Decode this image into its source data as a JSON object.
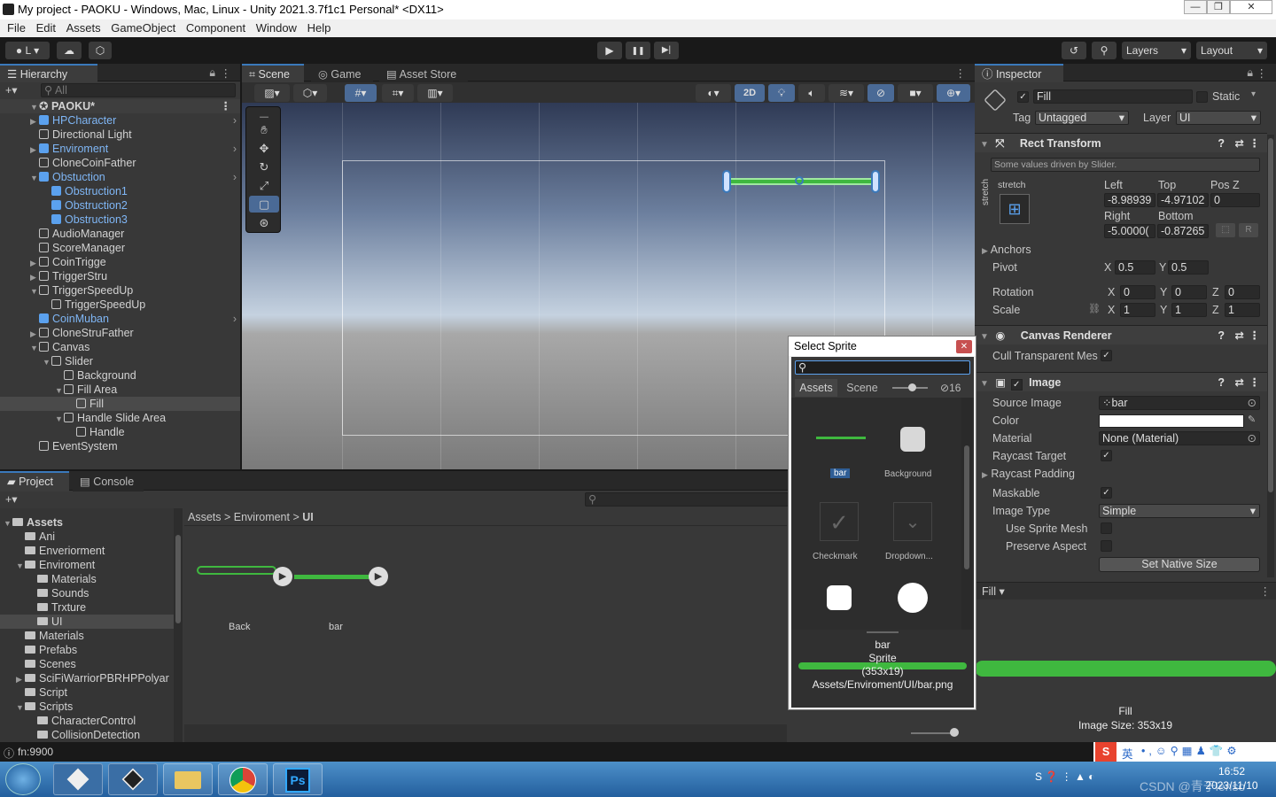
{
  "window": {
    "title": "My project - PAOKU - Windows, Mac, Linux - Unity 2021.3.7f1c1 Personal* <DX11>",
    "min": "—",
    "max": "❐",
    "close": "✕"
  },
  "menu": [
    "File",
    "Edit",
    "Assets",
    "GameObject",
    "Component",
    "Window",
    "Help"
  ],
  "toolbar": {
    "account": "L",
    "layers": "Layers",
    "layout": "Layout",
    "play": "▶",
    "pause": "❚❚",
    "step": "▶|"
  },
  "hierarchy": {
    "tab": "Hierarchy",
    "search_placeholder": "All",
    "scene": "PAOKU*",
    "items": [
      {
        "label": "HPCharacter",
        "prefab": true,
        "depth": 1,
        "fold": "▶"
      },
      {
        "label": "Directional Light",
        "prefab": false,
        "depth": 1,
        "fold": ""
      },
      {
        "label": "Enviroment",
        "prefab": true,
        "depth": 1,
        "fold": "▶"
      },
      {
        "label": "CloneCoinFather",
        "prefab": false,
        "depth": 1,
        "fold": ""
      },
      {
        "label": "Obstuction",
        "prefab": true,
        "depth": 1,
        "fold": "▼"
      },
      {
        "label": "Obstruction1",
        "prefab": true,
        "depth": 2,
        "fold": ""
      },
      {
        "label": "Obstruction2",
        "prefab": true,
        "depth": 2,
        "fold": ""
      },
      {
        "label": "Obstruction3",
        "prefab": true,
        "depth": 2,
        "fold": ""
      },
      {
        "label": "AudioManager",
        "prefab": false,
        "depth": 1,
        "fold": ""
      },
      {
        "label": "ScoreManager",
        "prefab": false,
        "depth": 1,
        "fold": ""
      },
      {
        "label": "CoinTrigge",
        "prefab": false,
        "depth": 1,
        "fold": "▶"
      },
      {
        "label": "TriggerStru",
        "prefab": false,
        "depth": 1,
        "fold": "▶"
      },
      {
        "label": "TriggerSpeedUp",
        "prefab": false,
        "depth": 1,
        "fold": "▼"
      },
      {
        "label": "TriggerSpeedUp",
        "prefab": false,
        "depth": 2,
        "fold": ""
      },
      {
        "label": "CoinMuban",
        "prefab": true,
        "depth": 1,
        "fold": ""
      },
      {
        "label": "CloneStruFather",
        "prefab": false,
        "depth": 1,
        "fold": "▶"
      },
      {
        "label": "Canvas",
        "prefab": false,
        "depth": 1,
        "fold": "▼"
      },
      {
        "label": "Slider",
        "prefab": false,
        "depth": 2,
        "fold": "▼"
      },
      {
        "label": "Background",
        "prefab": false,
        "depth": 3,
        "fold": ""
      },
      {
        "label": "Fill Area",
        "prefab": false,
        "depth": 3,
        "fold": "▼"
      },
      {
        "label": "Fill",
        "prefab": false,
        "depth": 4,
        "fold": "",
        "selected": true
      },
      {
        "label": "Handle Slide Area",
        "prefab": false,
        "depth": 3,
        "fold": "▼"
      },
      {
        "label": "Handle",
        "prefab": false,
        "depth": 4,
        "fold": ""
      },
      {
        "label": "EventSystem",
        "prefab": false,
        "depth": 1,
        "fold": ""
      }
    ]
  },
  "scene": {
    "tabs": [
      "Scene",
      "Game",
      "Asset Store"
    ],
    "btn2d": "2D"
  },
  "project": {
    "tabs": [
      "Project",
      "Console"
    ],
    "breadcrumb": [
      "Assets",
      "Enviroment",
      "UI"
    ],
    "tree": [
      {
        "label": "Assets",
        "depth": 0,
        "fold": "▼",
        "bold": true
      },
      {
        "label": "Ani",
        "depth": 1,
        "fold": ""
      },
      {
        "label": "Enveriorment",
        "depth": 1,
        "fold": ""
      },
      {
        "label": "Enviroment",
        "depth": 1,
        "fold": "▼"
      },
      {
        "label": "Materials",
        "depth": 2,
        "fold": ""
      },
      {
        "label": "Sounds",
        "depth": 2,
        "fold": ""
      },
      {
        "label": "Trxture",
        "depth": 2,
        "fold": ""
      },
      {
        "label": "UI",
        "depth": 2,
        "fold": "",
        "selected": true
      },
      {
        "label": "Materials",
        "depth": 1,
        "fold": ""
      },
      {
        "label": "Prefabs",
        "depth": 1,
        "fold": ""
      },
      {
        "label": "Scenes",
        "depth": 1,
        "fold": ""
      },
      {
        "label": "SciFiWarriorPBRHPPolyar",
        "depth": 1,
        "fold": "▶"
      },
      {
        "label": "Script",
        "depth": 1,
        "fold": ""
      },
      {
        "label": "Scripts",
        "depth": 1,
        "fold": "▼"
      },
      {
        "label": "CharacterControl",
        "depth": 2,
        "fold": ""
      },
      {
        "label": "CollisionDetection",
        "depth": 2,
        "fold": ""
      }
    ],
    "assets": [
      "Back",
      "bar"
    ]
  },
  "inspector": {
    "tab": "Inspector",
    "object_name": "Fill",
    "static_label": "Static",
    "tag_label": "Tag",
    "tag_value": "Untagged",
    "layer_label": "Layer",
    "layer_value": "UI",
    "rect": {
      "title": "Rect Transform",
      "note": "Some values driven by Slider.",
      "stretch": "stretch",
      "stretch_v": "stretch",
      "left_label": "Left",
      "top_label": "Top",
      "posz_label": "Pos Z",
      "left": "-8.98939",
      "top": "-4.97102",
      "posz": "0",
      "right_label": "Right",
      "bottom_label": "Bottom",
      "right": "-5.0000(",
      "bottom": "-0.87265",
      "r_btn": "R",
      "anchors": "Anchors",
      "pivot": "Pivot",
      "pivot_x": "0.5",
      "pivot_y": "0.5",
      "rotation": "Rotation",
      "rot_x": "0",
      "rot_y": "0",
      "rot_z": "0",
      "scale": "Scale",
      "sc_x": "1",
      "sc_y": "1",
      "sc_z": "1"
    },
    "canvas_renderer": {
      "title": "Canvas Renderer",
      "cull": "Cull Transparent Mes"
    },
    "image": {
      "title": "Image",
      "source_label": "Source Image",
      "source_value": "bar",
      "color_label": "Color",
      "material_label": "Material",
      "material_value": "None (Material)",
      "raycast_target": "Raycast Target",
      "raycast_padding": "Raycast Padding",
      "maskable": "Maskable",
      "image_type_label": "Image Type",
      "image_type_value": "Simple",
      "use_sprite_mesh": "Use Sprite Mesh",
      "preserve_aspect": "Preserve Aspect",
      "set_native": "Set Native Size"
    },
    "preview": {
      "label": "Fill",
      "name": "Fill",
      "size": "Image Size: 353x19"
    }
  },
  "dialog": {
    "title": "Select Sprite",
    "tab_assets": "Assets",
    "tab_scene": "Scene",
    "hidden_count": "16",
    "items": [
      "bar",
      "Background",
      "Checkmark",
      "Dropdown...",
      "",
      ""
    ],
    "info": {
      "name": "bar",
      "type": "Sprite",
      "dims": "(353x19)",
      "path": "Assets/Enviroment/UI/bar.png"
    }
  },
  "status": {
    "text": "fn:9900"
  },
  "taskbar": {
    "time": "16:52",
    "date": "2023/11/10",
    "ime": "英",
    "watermark": "CSDN @青于lenso"
  },
  "colors": {
    "accent": "#3a79bb",
    "green": "#3fb83f",
    "prefab_blue": "#7fb6f5"
  }
}
